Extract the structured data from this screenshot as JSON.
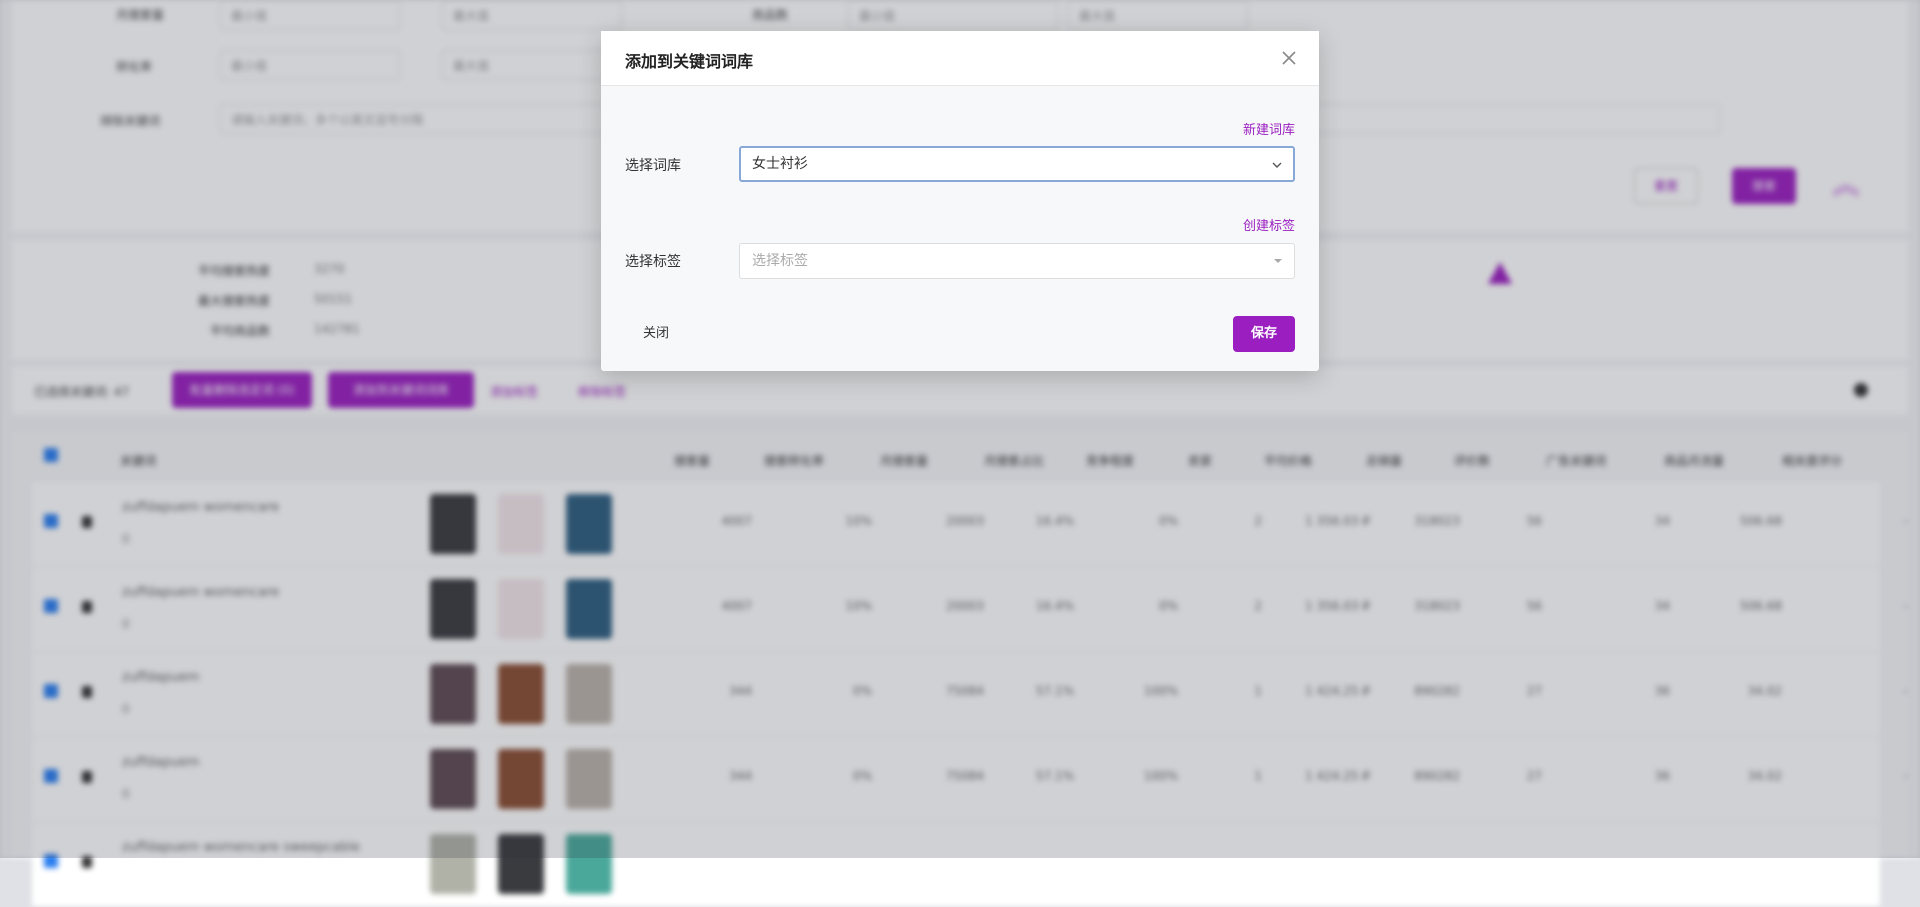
{
  "dialog": {
    "title": "添加到关键词词库",
    "new_library_link": "新建词库",
    "library_label": "选择词库",
    "library_value": "女士衬衫",
    "create_tag_link": "创建标签",
    "tag_label": "选择标签",
    "tag_placeholder": "选择标签",
    "close_label": "关闭",
    "save_label": "保存"
  },
  "background": {
    "filters": {
      "row1_label": "月搜索量",
      "row2_label": "转化率",
      "row3_label": "排除关键词",
      "row3_placeholder": "请输入关键词，多个以英文逗号分隔",
      "min_placeholder": "最小值",
      "max_placeholder": "最大值",
      "percent": "%",
      "row1_right_label": "商品数",
      "reset": "重置",
      "search": "搜索"
    },
    "stats": [
      {
        "label": "平均搜索热度",
        "value": "3270"
      },
      {
        "label": "最大搜索热度",
        "value": "50151"
      },
      {
        "label": "平均商品数",
        "value": "142781"
      }
    ],
    "toolbar": {
      "selected": "已选择关键词: 47",
      "btn1": "批量删除选定词 (0)",
      "btn2": "添加到关键词词库",
      "link1": "添加标签",
      "link2": "移除标签"
    },
    "table": {
      "headers": [
        "关键词",
        "搜索量",
        "搜索转化率",
        "月搜索量",
        "月搜索占比",
        "竞争程度",
        "卖家",
        "平均价格",
        "总销量",
        "评价数",
        "广告关键词",
        "商品月流量",
        "相关度评分"
      ],
      "rows": [
        {
          "keyword": "zuffdapuem womencare",
          "num": "0",
          "cells": [
            "4007",
            "10%",
            "20003",
            "16.4%",
            "0%",
            "2",
            "1 356.03 ₽",
            "318023",
            "56",
            "34",
            "506.68",
            "-"
          ],
          "thumbs": [
            "#3a3b3f",
            "#f2e6ea",
            "#2e5f80"
          ]
        },
        {
          "keyword": "zuffdapuem womencare",
          "num": "0",
          "cells": [
            "4007",
            "10%",
            "20003",
            "16.4%",
            "0%",
            "2",
            "1 356.03 ₽",
            "318023",
            "56",
            "34",
            "506.68",
            "-"
          ],
          "thumbs": [
            "#3a3b3f",
            "#f2e6ea",
            "#2e5f80"
          ]
        },
        {
          "keyword": "zuffdapuem",
          "num": "0",
          "cells": [
            "344",
            "0%",
            "75084",
            "57.1%",
            "100%",
            "1",
            "1 424.25 ₽",
            "890282",
            "27",
            "36",
            "34.02",
            "-"
          ],
          "thumbs": [
            "#5f4b52",
            "#8a4d32",
            "#bab2aa"
          ]
        },
        {
          "keyword": "zuffdapuem",
          "num": "0",
          "cells": [
            "344",
            "0%",
            "75084",
            "57.1%",
            "100%",
            "1",
            "1 424.25 ₽",
            "890282",
            "27",
            "36",
            "34.02",
            "-"
          ],
          "thumbs": [
            "#5f4b52",
            "#8a4d32",
            "#bab2aa"
          ]
        },
        {
          "keyword": "zuffdapuem womencare sweepcable",
          "num": "",
          "cells": [
            "",
            "",
            "",
            "",
            "",
            "",
            "",
            "",
            "",
            "",
            "",
            ""
          ],
          "thumbs": [
            "#b0b2a8",
            "#3a3b3f",
            "#4aa89a"
          ]
        }
      ]
    }
  },
  "colors": {
    "accent": "#9b1fc0",
    "checkbox": "#2a7ef0"
  }
}
